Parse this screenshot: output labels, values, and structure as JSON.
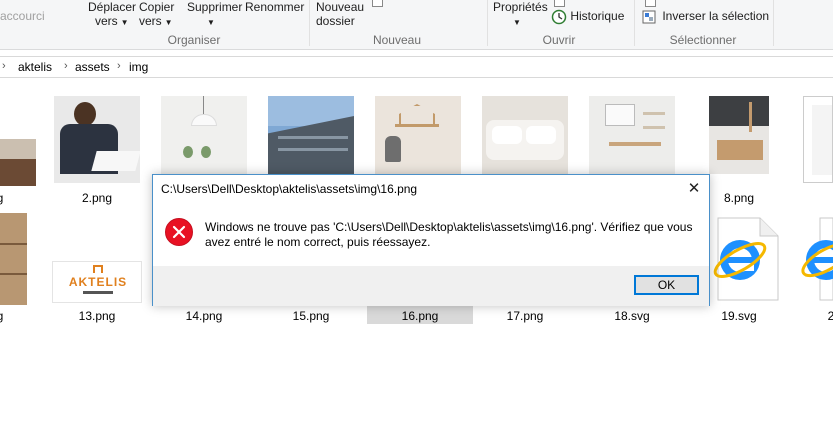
{
  "ribbon": {
    "undo_label": "accourci",
    "move_label_1": "Déplacer",
    "move_label_2": "vers",
    "copy_label_1": "Copier",
    "copy_label_2": "vers",
    "delete_label": "Supprimer",
    "rename_label": "Renommer",
    "new_folder_label_1": "Nouveau",
    "new_folder_label_2": "dossier",
    "properties_label": "Propriétés",
    "history_label": "Historique",
    "invert_label": "Inverser la sélection",
    "groups": {
      "organiser": "Organiser",
      "nouveau": "Nouveau",
      "ouvrir": "Ouvrir",
      "selectionner": "Sélectionner"
    }
  },
  "breadcrumb": [
    "aktelis",
    "assets",
    "img"
  ],
  "files_row1": [
    {
      "name": "g",
      "icon": "image-thumbnail"
    },
    {
      "name": "2.png",
      "icon": "image-thumbnail"
    },
    {
      "name": "",
      "icon": "image-thumbnail"
    },
    {
      "name": "",
      "icon": "image-thumbnail"
    },
    {
      "name": "",
      "icon": "image-thumbnail"
    },
    {
      "name": "",
      "icon": "image-thumbnail"
    },
    {
      "name": "",
      "icon": "image-thumbnail"
    },
    {
      "name": "8.png",
      "icon": "image-thumbnail"
    },
    {
      "name": "",
      "icon": "image-thumbnail"
    }
  ],
  "files_row2": [
    {
      "name": "g",
      "icon": "image-thumbnail"
    },
    {
      "name": "13.png",
      "icon": "image-thumbnail"
    },
    {
      "name": "14.png",
      "icon": "image-thumbnail"
    },
    {
      "name": "15.png",
      "icon": "image-thumbnail"
    },
    {
      "name": "16.png",
      "icon": "image-thumbnail"
    },
    {
      "name": "17.png",
      "icon": "image-thumbnail"
    },
    {
      "name": "18.svg",
      "icon": "svg-file-icon"
    },
    {
      "name": "19.svg",
      "icon": "svg-file-icon"
    },
    {
      "name": "2",
      "icon": "svg-file-icon"
    }
  ],
  "logo_text": "AKTELIS",
  "dialog": {
    "title": "C:\\Users\\Dell\\Desktop\\aktelis\\assets\\img\\16.png",
    "message_line1": "Windows ne trouve pas 'C:\\Users\\Dell\\Desktop\\aktelis\\assets\\img\\16.png'. Vérifiez que vous",
    "message_line2": "avez entré le nom correct, puis réessayez.",
    "ok_label": "OK",
    "close_glyph": "✕",
    "error_glyph": "✕"
  },
  "colors": {
    "dialog_border": "#4a90c9",
    "error_red": "#e81123",
    "ok_focus": "#0078d7",
    "selection": "#d9d9d9"
  }
}
